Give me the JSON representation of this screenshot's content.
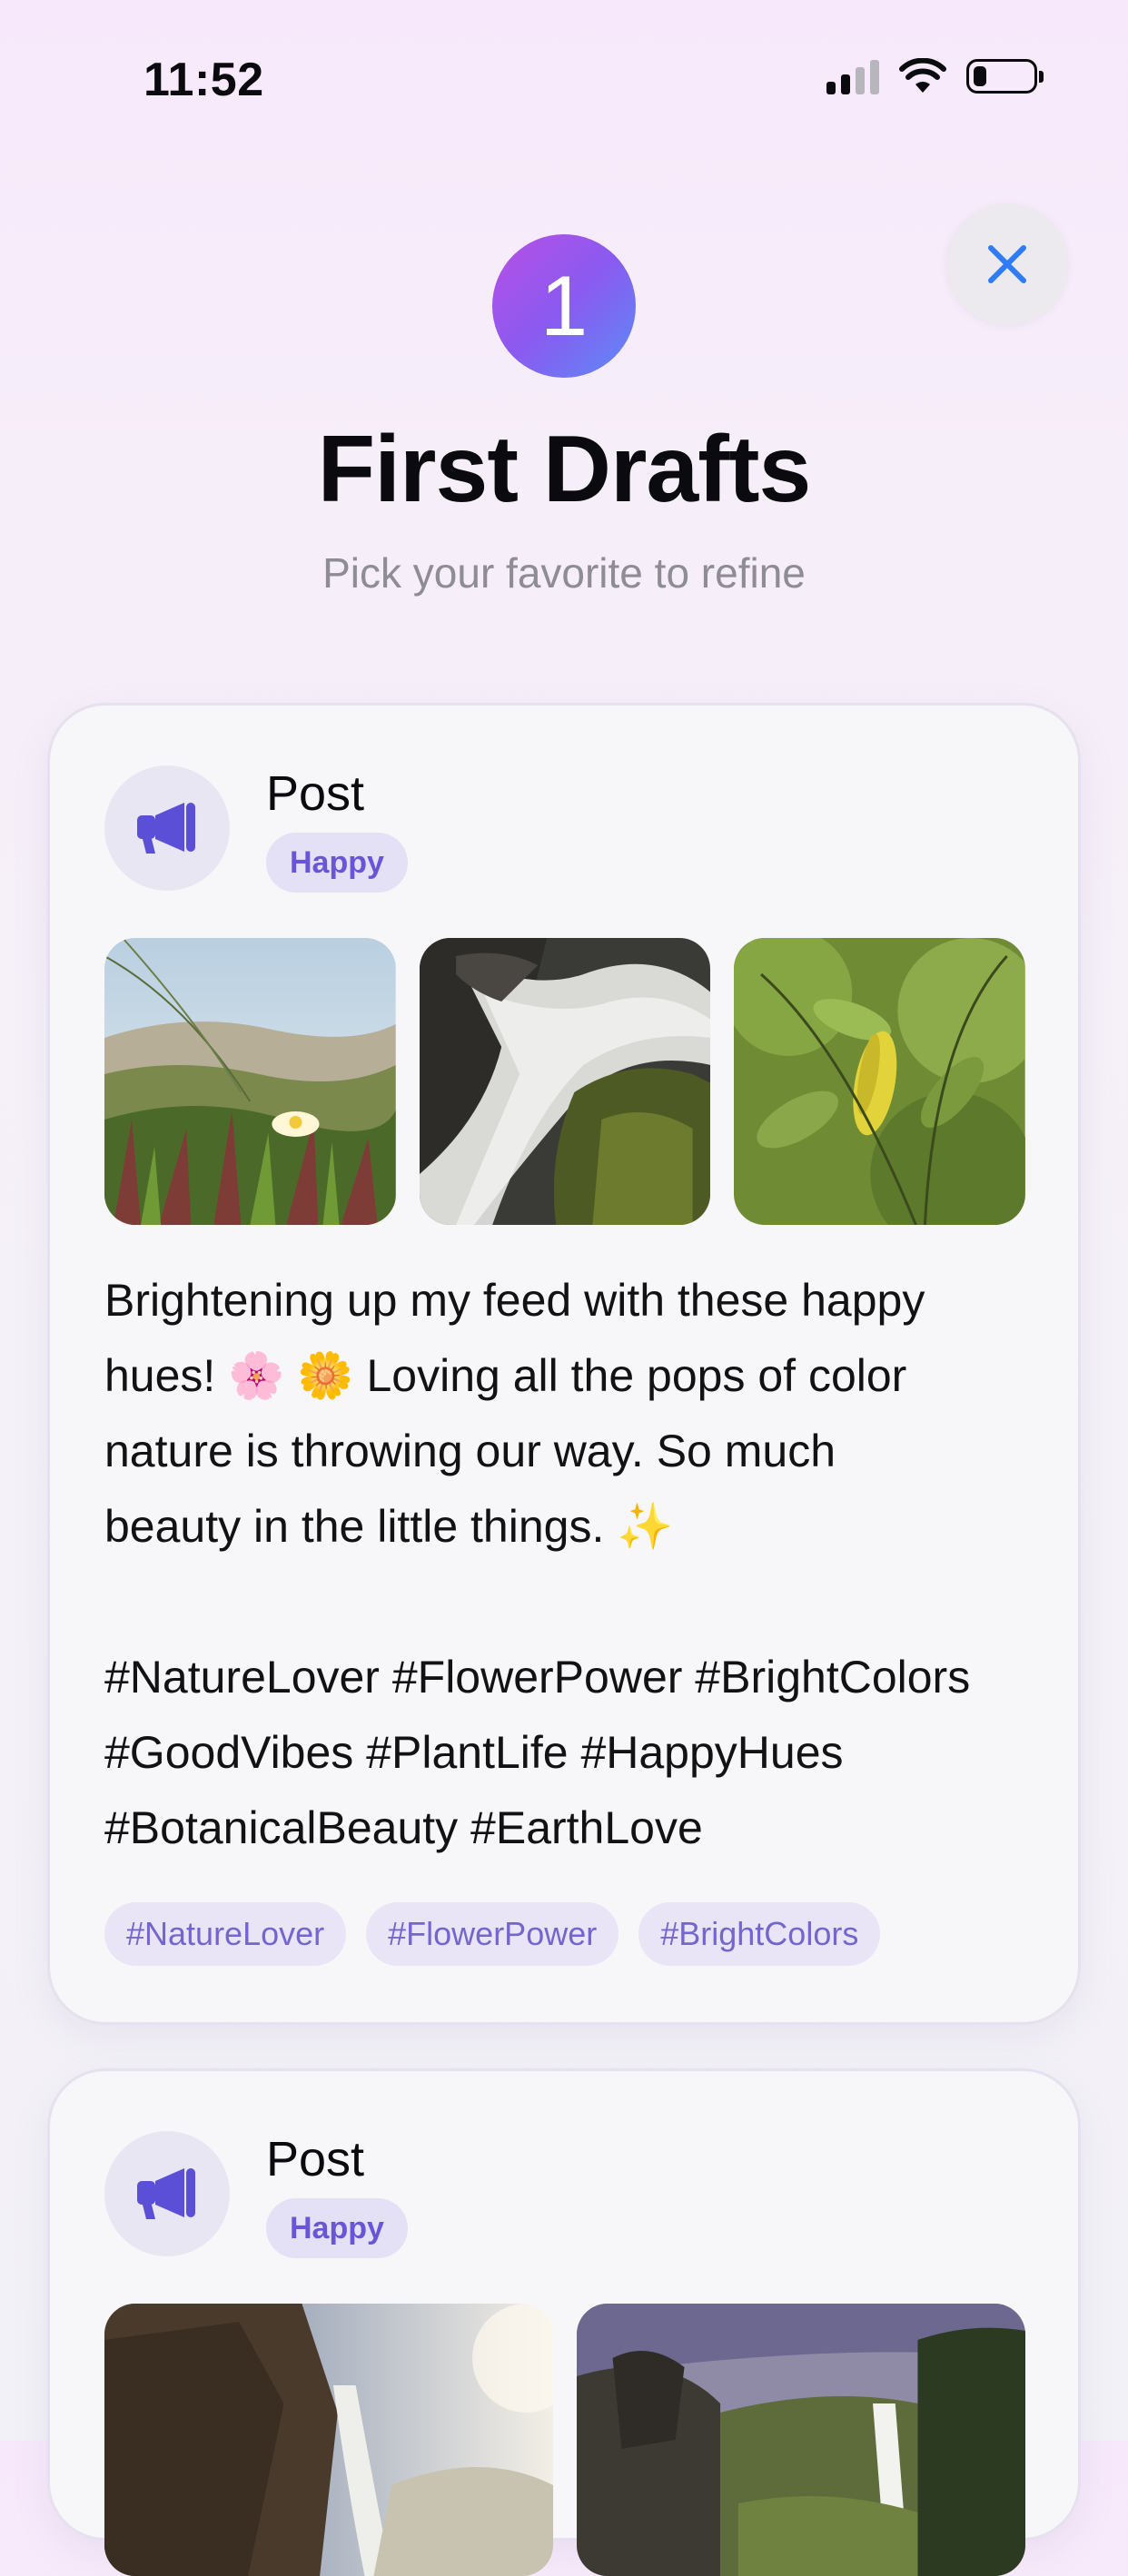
{
  "status_bar": {
    "time": "11:52"
  },
  "header": {
    "step_number": "1",
    "title": "First Drafts",
    "subtitle": "Pick your favorite to refine"
  },
  "icons": {
    "close": "close-icon",
    "post_type": "megaphone-icon"
  },
  "colors": {
    "accent": "#6a55d8",
    "close_icon": "#2f7cf6",
    "badge_gradient_start": "#b84fe6",
    "badge_gradient_end": "#5b8cf8"
  },
  "cards": [
    {
      "type_label": "Post",
      "mood": "Happy",
      "body": "Brightening up my feed with these happy\nhues! 🌸 🌼 Loving all the pops of color\nnature is throwing our way. So much\nbeauty in the little things. ✨\n\n#NatureLover #FlowerPower #BrightColors\n#GoodVibes #PlantLife #HappyHues\n#BotanicalBeauty #EarthLove",
      "tags": [
        "#NatureLover",
        "#FlowerPower",
        "#BrightColors"
      ]
    },
    {
      "type_label": "Post",
      "mood": "Happy"
    }
  ]
}
